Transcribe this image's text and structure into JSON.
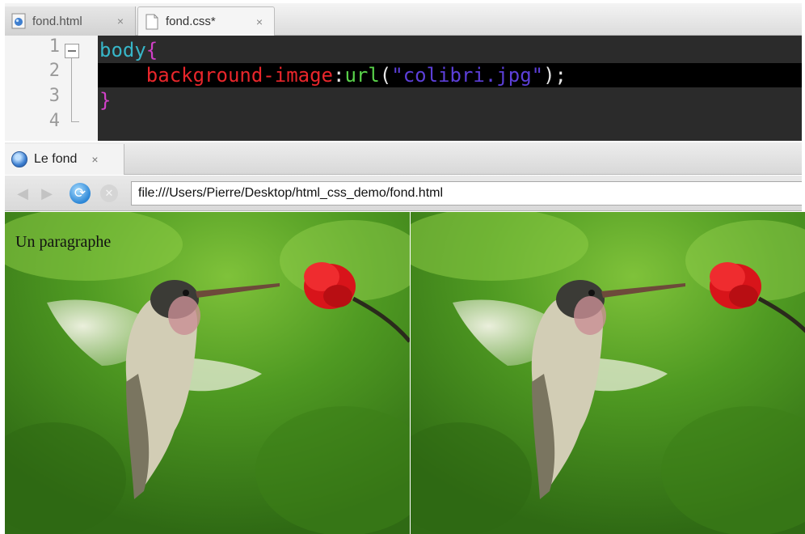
{
  "editor": {
    "tabs": [
      {
        "label": "fond.html",
        "active": false
      },
      {
        "label": "fond.css*",
        "active": true
      }
    ],
    "close_glyph": "×",
    "line_numbers": [
      "1",
      "2",
      "3",
      "4"
    ],
    "code": {
      "line1": {
        "selector": "body",
        "brace": "{"
      },
      "line2": {
        "indent": "    ",
        "property": "background-image",
        "colon": ":",
        "func": "url",
        "open": "(",
        "string": "\"colibri.jpg\"",
        "close": ");"
      },
      "line3": {
        "brace": "}"
      }
    },
    "colors": {
      "background": "#2b2b2b",
      "highlight": "#000000",
      "selector": "#37b6c8",
      "brace": "#d240c8",
      "property": "#e8262b",
      "function": "#59d24a",
      "string": "#5c3fd8"
    }
  },
  "browser": {
    "tab": {
      "label": "Le fond",
      "icon": "globe-icon"
    },
    "nav": {
      "back_icon": "back-arrow-icon",
      "forward_icon": "forward-arrow-icon",
      "reload_icon": "reload-icon",
      "stop_icon": "stop-icon"
    },
    "address": "file:///Users/Pierre/Desktop/html_css_demo/fond.html",
    "content": {
      "paragraph": "Un paragraphe",
      "background_image": "colibri.jpg",
      "background_repeat_tiles": 2
    }
  }
}
